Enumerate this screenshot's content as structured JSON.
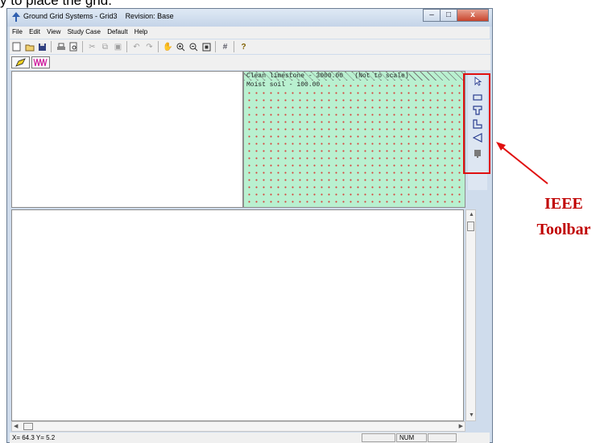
{
  "caption": "y to place the grid.",
  "window": {
    "title": "Ground Grid Systems - Grid3",
    "revision": "Revision: Base",
    "buttons": {
      "minimize": "–",
      "maximize": "□",
      "close": "x"
    }
  },
  "menu": [
    "File",
    "Edit",
    "View",
    "Study Case",
    "Default",
    "Help"
  ],
  "toolbar": [
    "new-icon",
    "open-icon",
    "save-icon",
    "print-icon",
    "print-preview-icon",
    "cut-icon",
    "copy-icon",
    "paste-icon",
    "undo-icon",
    "redo-icon",
    "pan-icon",
    "zoom-in-icon",
    "zoom-out-icon",
    "zoom-fit-icon",
    "grid-icon",
    "help-icon"
  ],
  "soil": {
    "top_layer": "Clean limestone - 3000.00   (Not to scale)",
    "bottom_layer": "Moist soil - 100.00",
    "colors": {
      "fill": "#b9f0d0",
      "dots": "#d8403a"
    }
  },
  "ieee_toolbar": [
    "pointer-icon",
    "rectangle-grid-icon",
    "t-shape-grid-icon",
    "l-shape-grid-icon",
    "triangle-grid-icon",
    "rod-icon"
  ],
  "status": {
    "coords": "X= 64.3  Y= 5.2",
    "num": "NUM"
  },
  "annotation": {
    "label_line1": "IEEE",
    "label_line2": "Toolbar",
    "color": "#c00000"
  }
}
